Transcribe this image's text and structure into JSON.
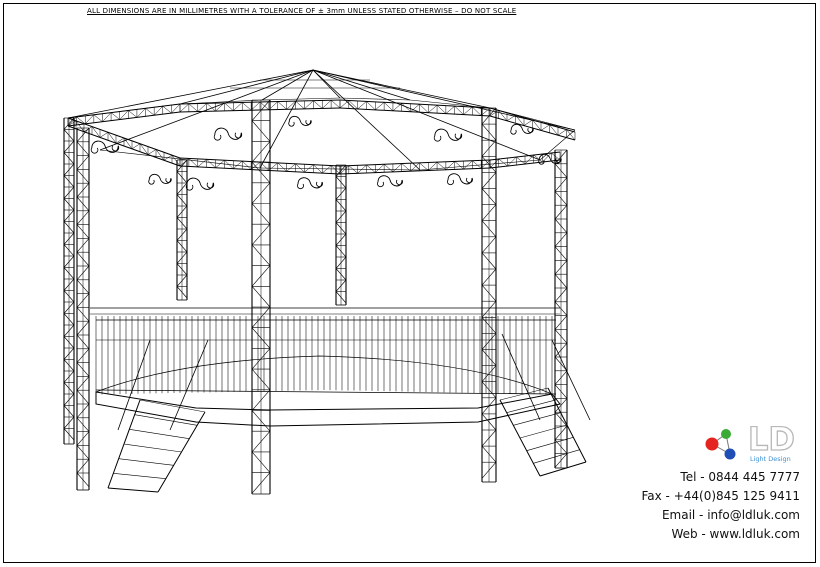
{
  "drawing": {
    "note": "ALL DIMENSIONS ARE IN MILLIMETRES WITH A TOLERANCE OF ± 3mm UNLESS STATED OTHERWISE  –  DO NOT SCALE"
  },
  "brand": {
    "tagline": "Light Design",
    "colors": {
      "red": "#e52421",
      "green": "#3aaa35",
      "blue": "#1f4fb5",
      "grey": "#b8b8b8",
      "tagline": "#3b8fd8"
    }
  },
  "contact": {
    "tel": "Tel - 0844 445 7777",
    "fax": "Fax - +44(0)845 125 9411",
    "email": "Email - info@ldluk.com",
    "web": "Web - www.ldluk.com"
  }
}
